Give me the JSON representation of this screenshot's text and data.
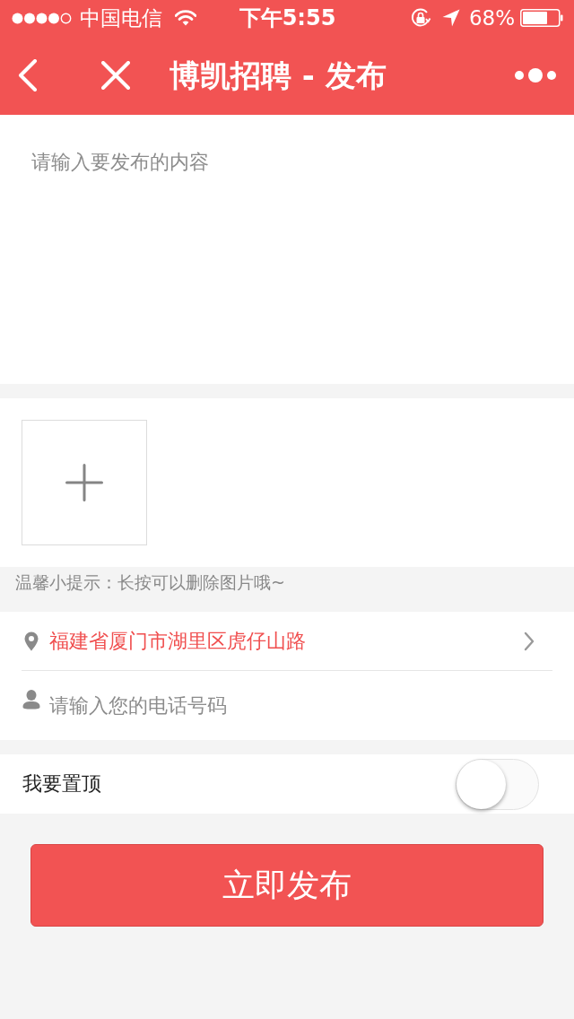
{
  "status_bar": {
    "carrier": "中国电信",
    "time": "下午5:55",
    "battery": "68%"
  },
  "nav_bar": {
    "title": "博凯招聘 - 发布"
  },
  "content": {
    "placeholder": "请输入要发布的内容"
  },
  "photos": {
    "hint": "温馨小提示：长按可以删除图片哦~"
  },
  "contact": {
    "location": "福建省厦门市湖里区虎仔山路",
    "phone": {
      "placeholder": "请输入您的电话号码"
    }
  },
  "pin_top": {
    "label": "我要置顶",
    "on": false
  },
  "submit": {
    "label": "立即发布"
  }
}
